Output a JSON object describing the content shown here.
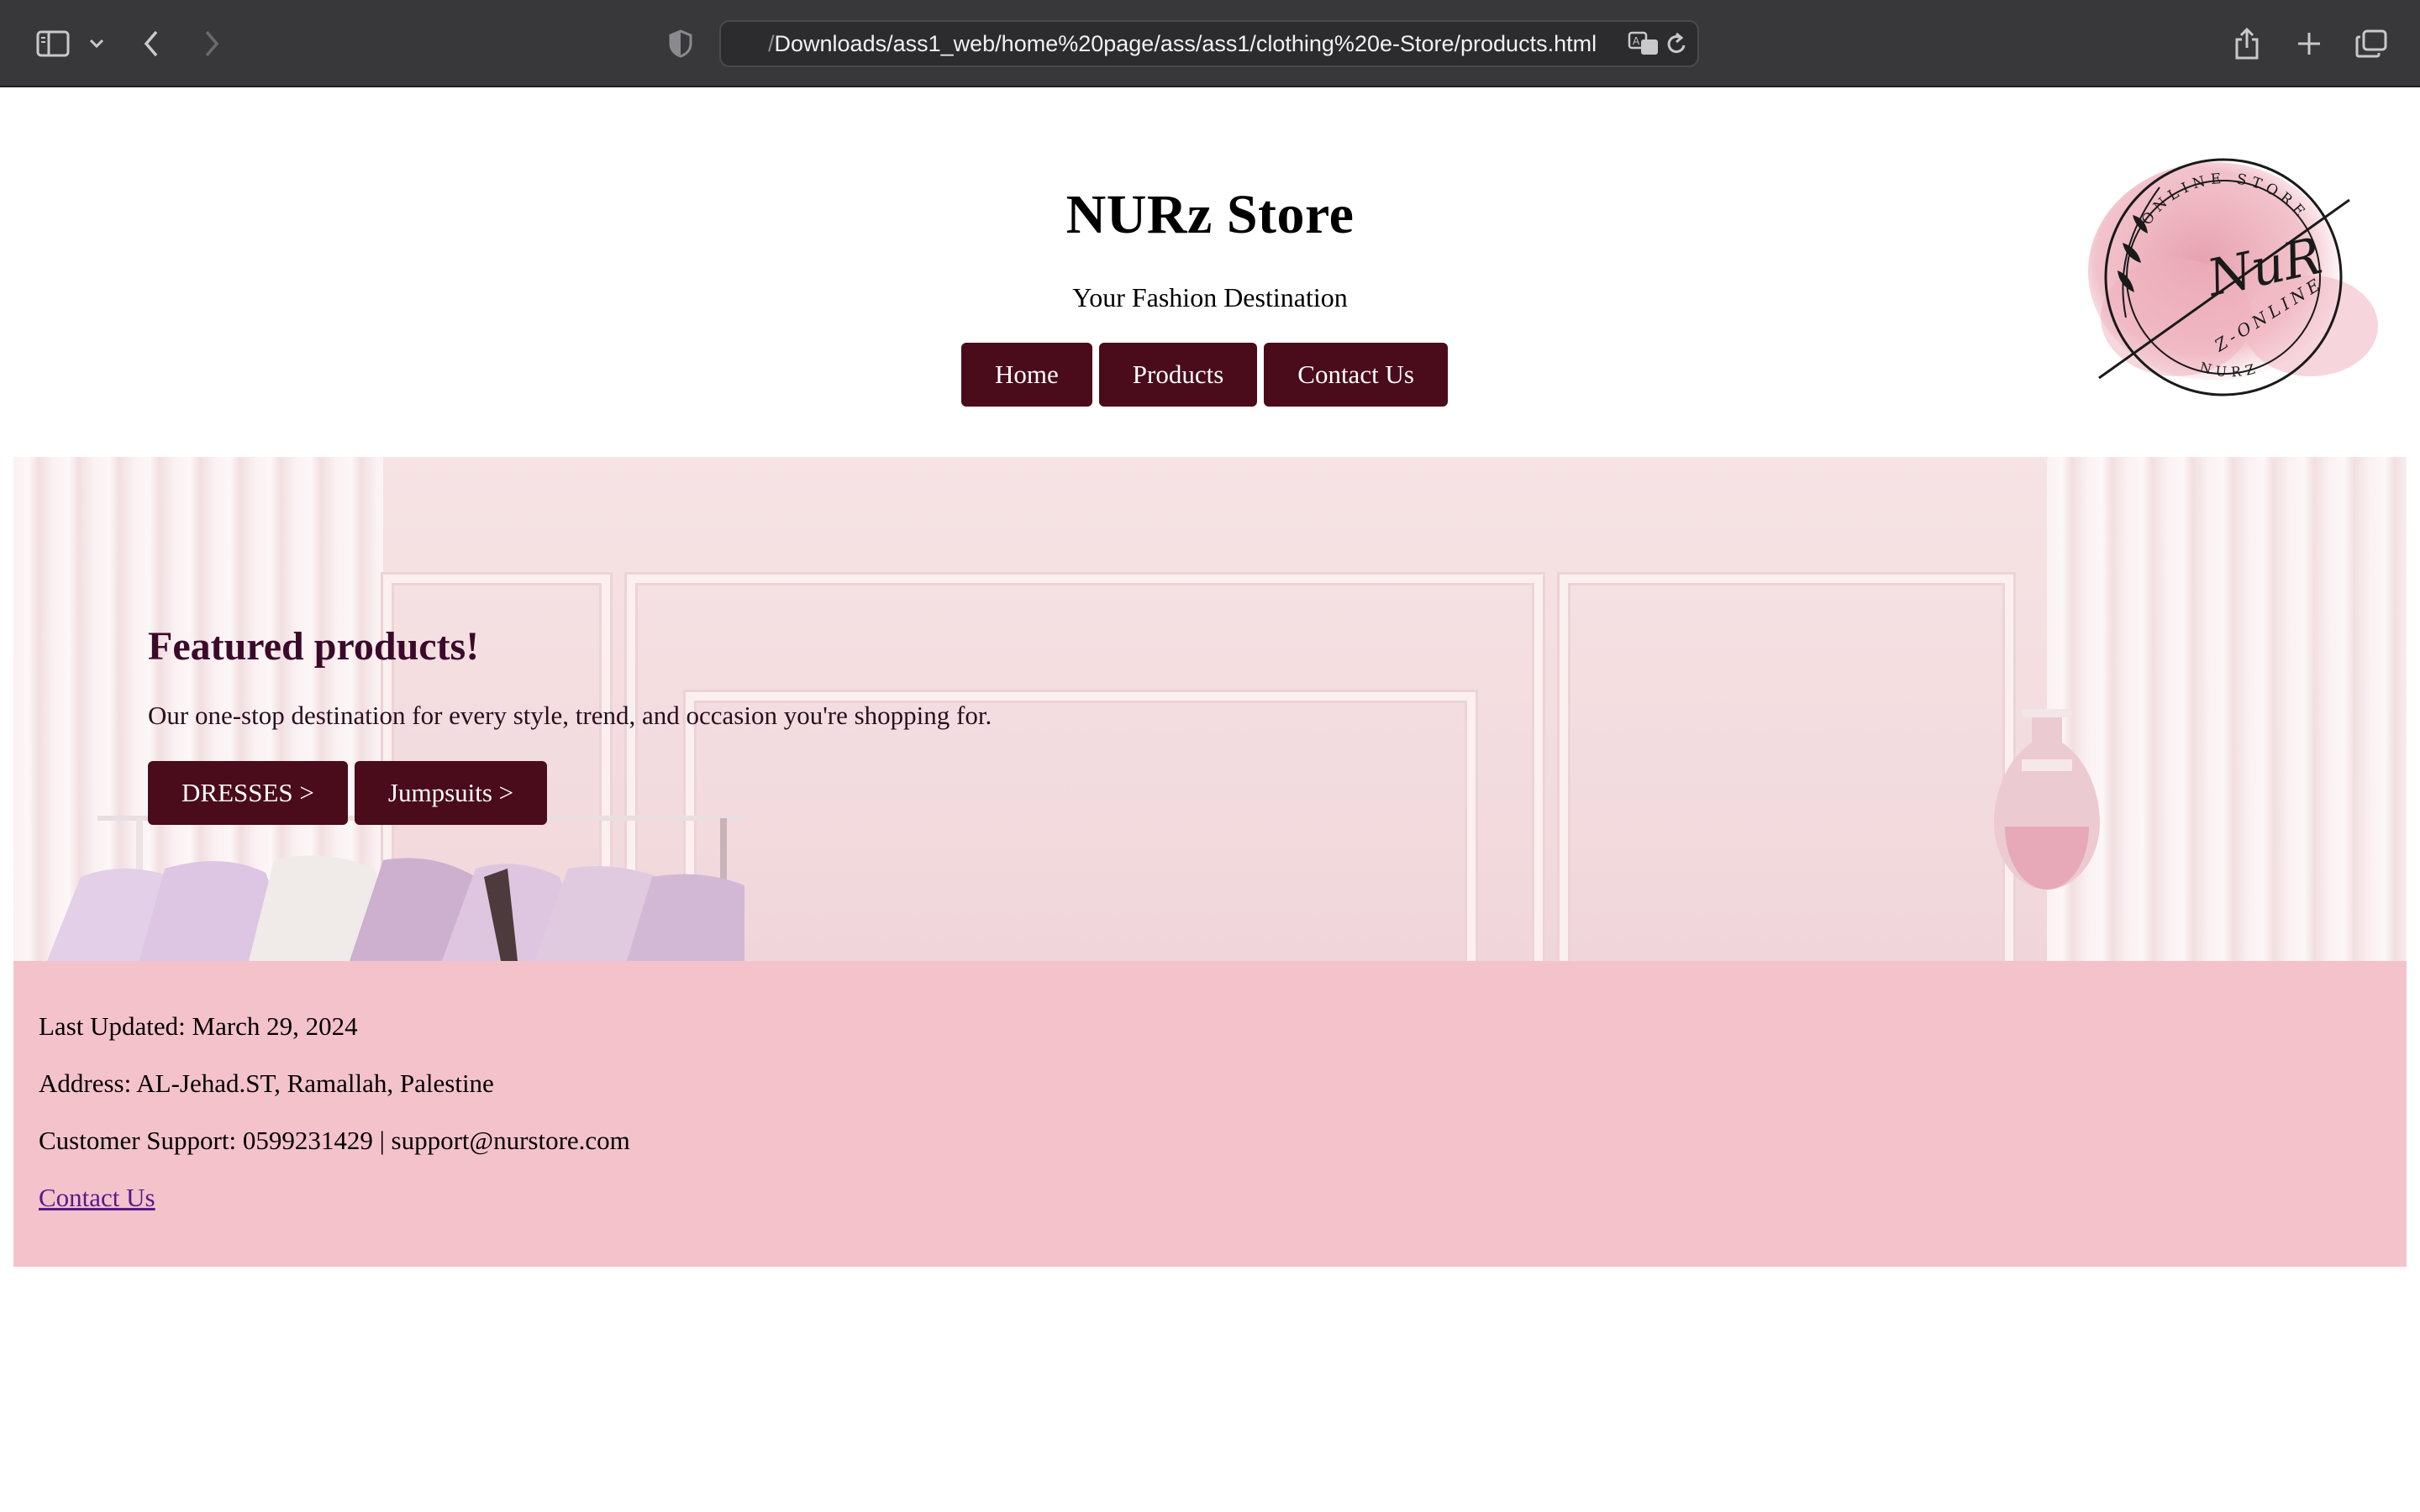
{
  "browser": {
    "url_prefix": "/",
    "url": "Downloads/ass1_web/home%20page/ass/ass1/clothing%20e-Store/products.html",
    "icons": [
      "sidebar-icon",
      "chevron-down-icon",
      "back-icon",
      "forward-icon",
      "shield-icon",
      "translate-icon",
      "reload-icon",
      "share-icon",
      "new-tab-icon",
      "tabs-overview-icon"
    ]
  },
  "header": {
    "title": "NURz Store",
    "subtitle": "Your Fashion Destination",
    "nav": [
      {
        "label": "Home"
      },
      {
        "label": "Products"
      },
      {
        "label": "Contact Us"
      }
    ],
    "logo": {
      "top_text": "ONLINE STORE",
      "monogram": "NuR",
      "band_text": "Z-ONLINE",
      "bottom_text": "NURZ"
    }
  },
  "hero": {
    "title": "Featured products!",
    "text": "Our one-stop destination for every style, trend, and occasion you're shopping for.",
    "buttons": [
      {
        "label": "DRESSES >"
      },
      {
        "label": "Jumpsuits >"
      }
    ]
  },
  "footer": {
    "last_updated": "Last Updated: March 29, 2024",
    "address": "Address: AL-Jehad.ST, Ramallah, Palestine",
    "support": "Customer Support: 0599231429 | support@nurstore.com",
    "contact_link": "Contact Us"
  },
  "colors": {
    "button_bg": "#4a0c1a",
    "footer_bg": "#f4c2cb",
    "hero_title": "#3b0a2a",
    "link": "#551a8b"
  }
}
